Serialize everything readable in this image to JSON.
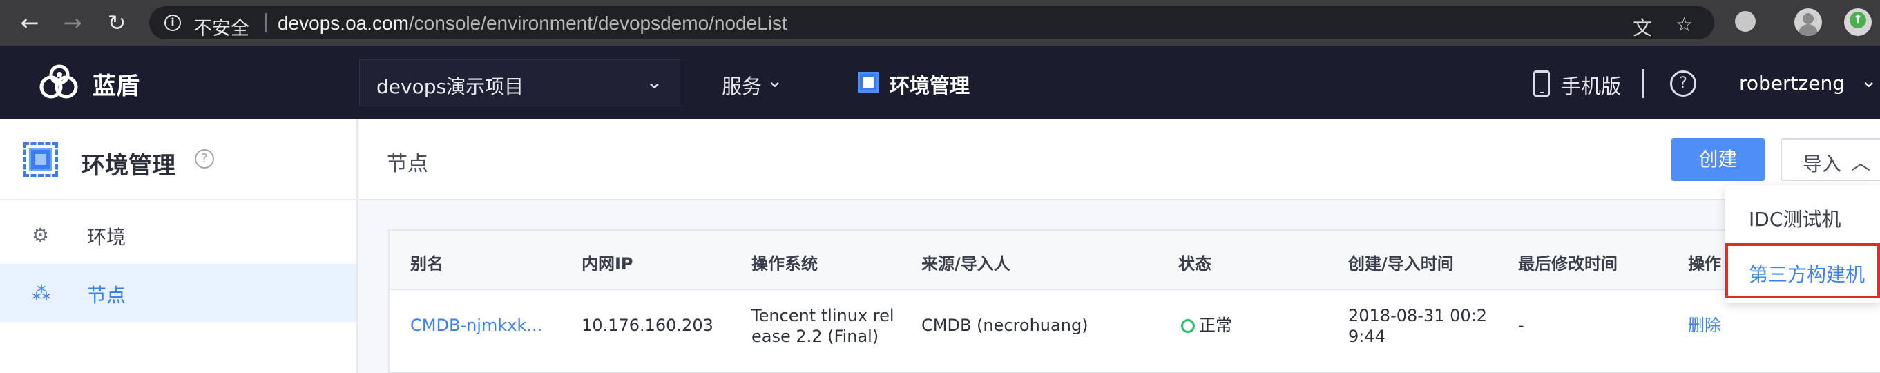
{
  "browser": {
    "security_label": "不安全",
    "url_host": "devops.oa.com",
    "url_path": "/console/environment/devopsdemo/nodeList",
    "icons": [
      "back-icon",
      "forward-icon",
      "reload-icon",
      "info-icon",
      "translate-icon",
      "star-icon",
      "extension-icon",
      "profile-icon",
      "update-icon"
    ]
  },
  "topbar": {
    "brand": "蓝盾",
    "project": "devops演示项目",
    "services": "服务",
    "env_mgmt": "环境管理",
    "mobile": "手机版",
    "help": "?",
    "username": "robertzeng"
  },
  "sidebar": {
    "title": "环境管理",
    "items": [
      {
        "label": "环境",
        "icon": "gear-icon",
        "active": false
      },
      {
        "label": "节点",
        "icon": "nodes-icon",
        "active": true
      }
    ]
  },
  "content": {
    "page_title": "节点",
    "create_button": "创建",
    "import_button": "导入"
  },
  "import_menu": {
    "items": [
      "IDC测试机",
      "第三方构建机"
    ],
    "highlighted": "第三方构建机"
  },
  "table": {
    "columns": [
      "别名",
      "内网IP",
      "操作系统",
      "来源/导入人",
      "状态",
      "创建/导入时间",
      "最后修改时间",
      "操作"
    ],
    "rows": [
      {
        "alias": "CMDB-njmkxk...",
        "ip": "10.176.160.203",
        "os_line1": "Tencent tlinux rel",
        "os_line2": "ease 2.2 (Final)",
        "source": "CMDB (necrohuang)",
        "status": "正常",
        "created_line1": "2018-08-31 00:2",
        "created_line2": "9:44",
        "modified": "-",
        "action": "删除"
      }
    ]
  },
  "colors": {
    "primary": "#4f8ef6",
    "link": "#3c82f0",
    "topbar_bg": "#1b1d2e",
    "status_ok": "#2bbf6a",
    "highlight_border": "#d93025"
  }
}
